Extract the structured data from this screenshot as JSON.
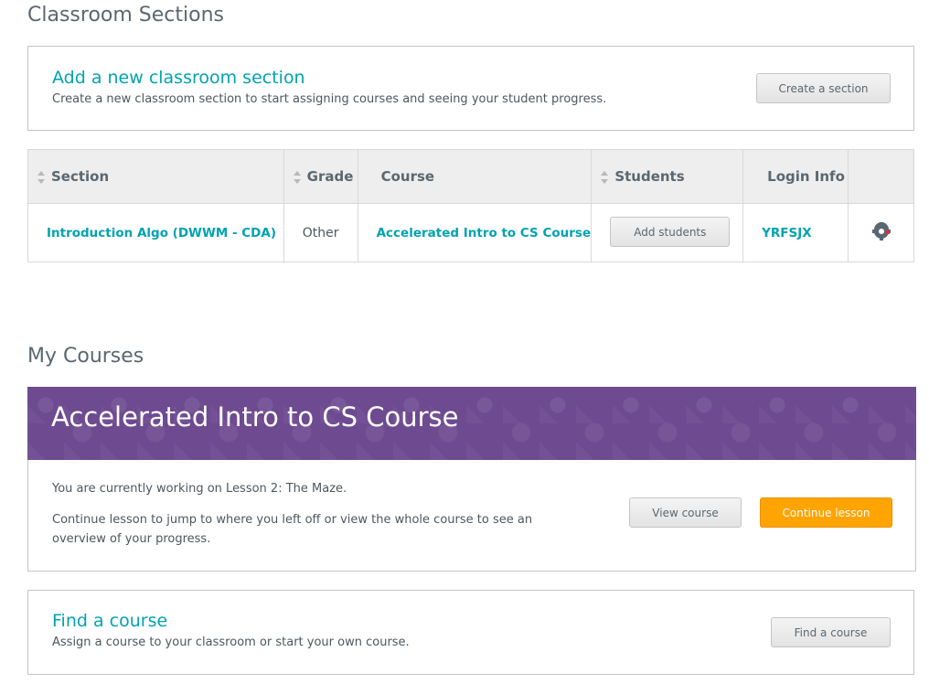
{
  "classroom_sections": {
    "heading": "Classroom Sections",
    "add_card": {
      "title": "Add a new classroom section",
      "description": "Create a new classroom section to start assigning courses and seeing your student progress.",
      "button_label": "Create a section"
    },
    "table": {
      "headers": [
        "Section",
        "Grade",
        "Course",
        "Students",
        "Login Info"
      ],
      "rows": [
        {
          "section": "Introduction Algo (DWWM - CDA)",
          "grade": "Other",
          "course": "Accelerated Intro to CS Course",
          "students_button": "Add students",
          "login_info": "YRFSJX",
          "settings_icon": "gear-icon"
        }
      ]
    }
  },
  "my_courses": {
    "heading": "My Courses",
    "course_card": {
      "title": "Accelerated Intro to CS Course",
      "current_lesson_text": "You are currently working on Lesson 2: The Maze.",
      "continue_text": "Continue lesson to jump to where you left off or view the whole course to see an overview of your progress.",
      "view_button": "View course",
      "continue_button": "Continue lesson"
    },
    "find_card": {
      "title": "Find a course",
      "description": "Assign a course to your classroom or start your own course.",
      "button_label": "Find a course"
    }
  },
  "colors": {
    "accent_teal": "#00a3b0",
    "banner_purple": "#6e4a91",
    "continue_orange": "#ffa400"
  }
}
